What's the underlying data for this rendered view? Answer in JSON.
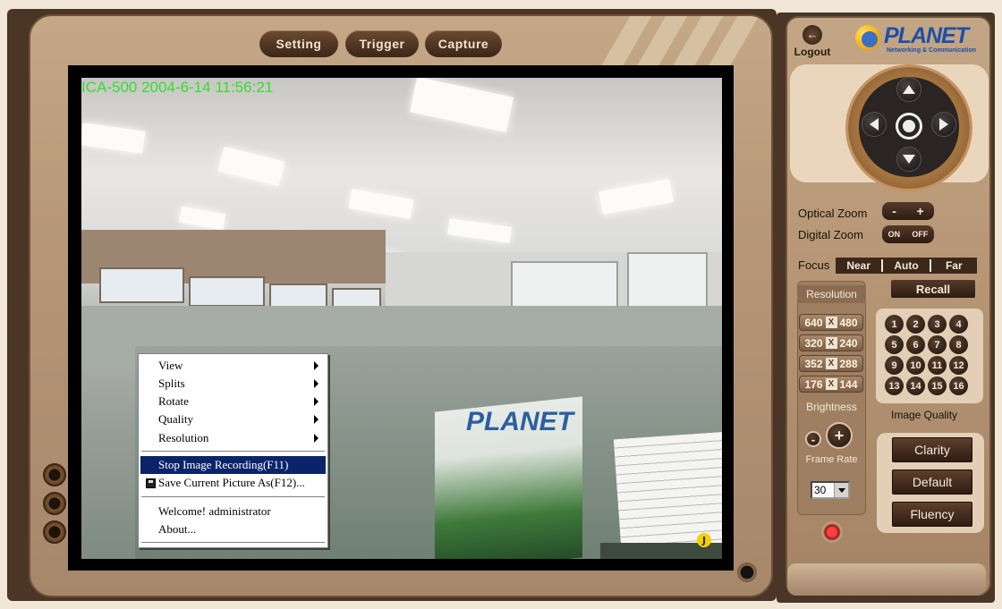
{
  "top_tabs": {
    "setting": "Setting",
    "trigger": "Trigger",
    "capture": "Capture"
  },
  "video": {
    "osd_text": "ICA-500  2004-6-14 11:56:21",
    "poster_text": "PLANET",
    "badge": "J"
  },
  "context_menu": {
    "view": "View",
    "splits": "Splits",
    "rotate": "Rotate",
    "quality": "Quality",
    "resolution": "Resolution",
    "stop_recording": "Stop Image Recording(F11)",
    "save_picture": "Save Current Picture As(F12)...",
    "welcome": "Welcome! administrator",
    "about": "About..."
  },
  "header": {
    "logout": "Logout",
    "logo_text": "PLANET",
    "logo_sub": "Networking & Communication"
  },
  "zoom": {
    "optical_label": "Optical Zoom",
    "minus": "-",
    "plus": "+",
    "digital_label": "Digital  Zoom",
    "on": "ON",
    "off": "OFF"
  },
  "focus": {
    "label": "Focus",
    "near": "Near",
    "auto": "Auto",
    "far": "Far"
  },
  "recall_label": "Recall",
  "resolution": {
    "title": "Resolution",
    "options": [
      {
        "w": "640",
        "h": "480"
      },
      {
        "w": "320",
        "h": "240"
      },
      {
        "w": "352",
        "h": "288"
      },
      {
        "w": "176",
        "h": "144"
      }
    ],
    "x_symbol": "X"
  },
  "brightness": {
    "label": "Brightness",
    "minus": "-",
    "plus": "+"
  },
  "frame_rate": {
    "label": "Frame Rate",
    "value": "30"
  },
  "presets": [
    "1",
    "2",
    "3",
    "4",
    "5",
    "6",
    "7",
    "8",
    "9",
    "10",
    "11",
    "12",
    "13",
    "14",
    "15",
    "16"
  ],
  "image_quality": {
    "label": "Image Quality",
    "clarity": "Clarity",
    "default": "Default",
    "fluency": "Fluency"
  },
  "colors": {
    "panel": "#b59474",
    "dark_button": "#2c1c12",
    "osd_green": "#30e030",
    "menu_highlight": "#0a246a"
  },
  "icons": [
    "logout-icon",
    "ptz-up-icon",
    "ptz-down-icon",
    "ptz-left-icon",
    "ptz-right-icon",
    "ptz-home-icon",
    "floppy-icon",
    "stop-icon"
  ]
}
